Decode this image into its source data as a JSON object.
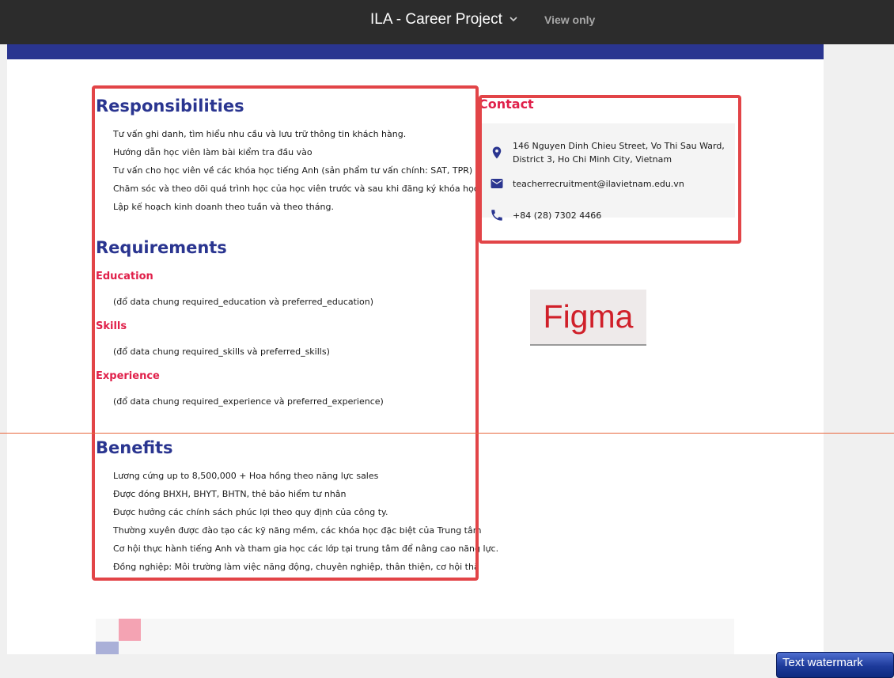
{
  "topbar": {
    "title": "ILA - Career Project",
    "view_mode": "View only",
    "chevron_icon": "chevron-down-icon"
  },
  "colors": {
    "brand_navy": "#2a3590",
    "accent_red": "#e0204a",
    "annotation_red": "#e24447",
    "guide_orange": "#e8663d"
  },
  "responsibilities": {
    "heading": "Responsibilities",
    "items": [
      "Tư vấn ghi danh, tìm hiểu nhu cầu và lưu trữ thông tin khách hàng.",
      "Hướng dẫn học viên làm bài kiểm tra đầu vào",
      "Tư vấn cho học viên về các khóa học tiếng Anh (sản phẩm tư vấn chính: SAT, TPR)",
      "Chăm sóc và theo dõi quá trình học của học viên trước và sau khi đăng ký khóa học.",
      "Lập kế hoạch kinh doanh theo tuần và theo tháng."
    ]
  },
  "requirements": {
    "heading": "Requirements",
    "education": {
      "label": "Education",
      "text": "(đổ data chung required_education và preferred_education)"
    },
    "skills": {
      "label": "Skills",
      "text": "(đổ data chung required_skills và preferred_skills)"
    },
    "experience": {
      "label": "Experience",
      "text": "(đổ data chung required_experience và preferred_experience)"
    }
  },
  "benefits": {
    "heading": "Benefits",
    "items": [
      "Lương cứng up to 8,500,000 + Hoa hồng theo năng lực sales",
      "Được đóng BHXH, BHYT, BHTN, thẻ bảo hiểm tư nhân",
      "Được hưởng các chính sách phúc lợi theo quy định của công ty.",
      "Thường xuyên được đào tạo các kỹ năng mềm, các khóa học đặc biệt của Trung tâm",
      "Cơ hội thực hành tiếng Anh và tham gia học các lớp tại trung tâm để nâng cao năng lực.",
      "Đồng nghiệp: Môi trường làm việc năng động, chuyên nghiệp, thân thiện, cơ hội thăng tiến"
    ]
  },
  "contact": {
    "heading": "Contact",
    "address_line1": "146 Nguyen Dinh Chieu Street, Vo Thi Sau Ward,",
    "address_line2": "District 3, Ho Chi Minh City, Vietnam",
    "email": "teacherrecruitment@ilavietnam.edu.vn",
    "phone": "+84 (28) 7302 4466",
    "icons": [
      "location-pin-icon",
      "mail-icon",
      "phone-icon"
    ]
  },
  "figma_badge": "Figma",
  "watermark": "Text watermark"
}
